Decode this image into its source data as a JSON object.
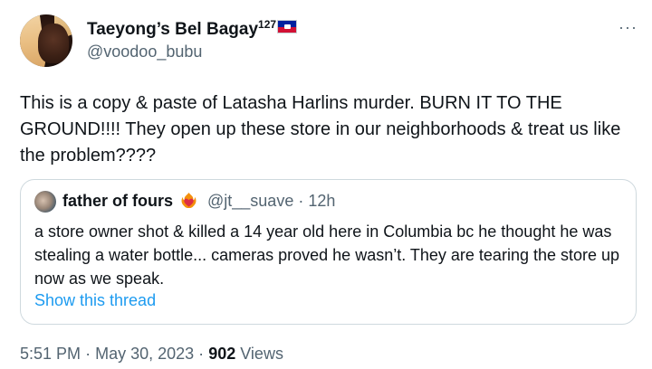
{
  "author": {
    "display_name": "Taeyong’s Bel Bagay",
    "name_superscript": "127",
    "flag_icon": "haiti-flag-icon",
    "handle": "@voodoo_bubu",
    "avatar_icon": "profile-avatar"
  },
  "more_button": {
    "label": "···",
    "icon": "more-options-icon"
  },
  "tweet": {
    "text": "This is a copy & paste of Latasha Harlins murder. BURN IT TO THE GROUND!!!! They open up these store in our neighborhoods & treat us like the problem????"
  },
  "quoted_tweet": {
    "display_name": "father of fours",
    "emoji_icon": "heart-on-fire-icon",
    "handle": "@jt__suave",
    "separator": "·",
    "time_ago": "12h",
    "text": "a store owner shot & killed a 14 year old here in Columbia bc he thought he was stealing a water bottle... cameras proved he wasn’t. They are tearing the store up now as we speak.",
    "show_thread_label": "Show this thread"
  },
  "meta": {
    "time": "5:51 PM",
    "separator": "·",
    "date": "May 30, 2023",
    "views_count": "902",
    "views_label": "Views"
  },
  "colors": {
    "text_primary": "#0f1419",
    "text_secondary": "#536471",
    "link": "#1d9bf0",
    "border": "#cfd9de"
  }
}
